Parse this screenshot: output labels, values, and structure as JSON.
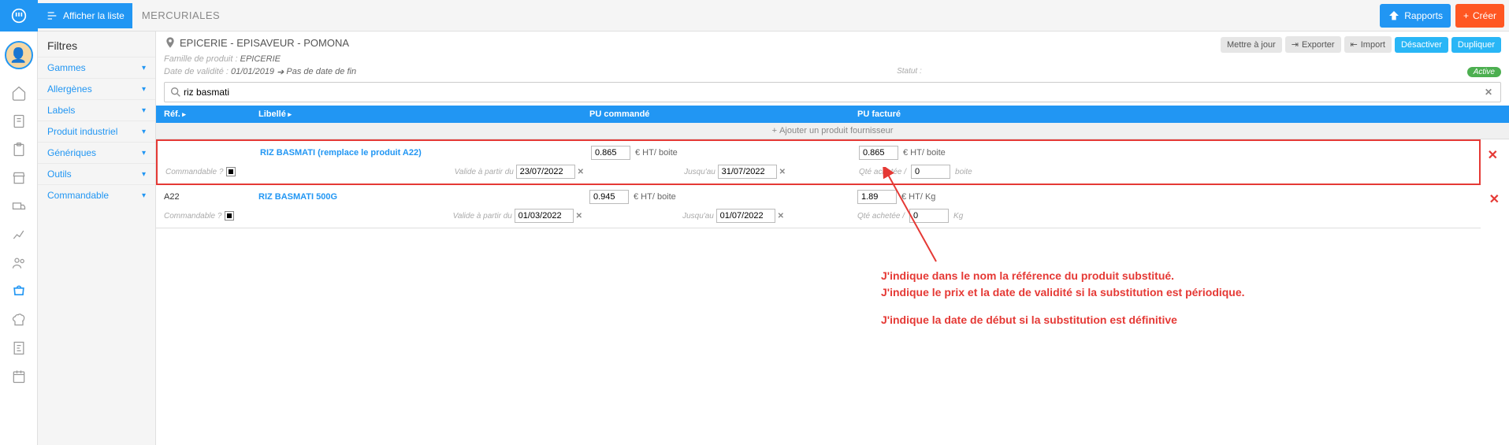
{
  "topbar": {
    "show_list": "Afficher la liste",
    "page_title": "MERCURIALES",
    "reports": "Rapports",
    "create": "Créer"
  },
  "sidebar": {
    "title": "Filtres",
    "items": [
      "Gammes",
      "Allergènes",
      "Labels",
      "Produit industriel",
      "Génériques",
      "Outils",
      "Commandable"
    ]
  },
  "header": {
    "breadcrumb": "EPICERIE - EPISAVEUR - POMONA",
    "family_label": "Famille de produit :",
    "family_value": "EPICERIE",
    "validity_label": "Date de validité :",
    "validity_start": "01/01/2019",
    "validity_arrow": "➔",
    "validity_end": "Pas de date de fin",
    "actions": {
      "update": "Mettre à jour",
      "export": "Exporter",
      "import": "Import",
      "deactivate": "Désactiver",
      "duplicate": "Dupliquer"
    },
    "status_label": "Statut :",
    "status_value": "Active"
  },
  "search": {
    "value": "riz basmati"
  },
  "columns": {
    "ref": "Réf.",
    "label": "Libellé",
    "pu_cmd": "PU commandé",
    "pu_fact": "PU facturé"
  },
  "add_row": "Ajouter un produit fournisseur",
  "row_labels": {
    "unit_prefix": "€ HT/",
    "commandable": "Commandable ?",
    "valid_from": "Valide à partir du",
    "until": "Jusqu'au",
    "qty_bought": "Qté achetée /"
  },
  "products": [
    {
      "ref": "",
      "label": "RIZ BASMATI (remplace le produit A22)",
      "pu_cmd": "0.865",
      "unit_cmd": "boite",
      "pu_fact": "0.865",
      "unit_fact": "boite",
      "valid_from": "23/07/2022",
      "until": "31/07/2022",
      "qty": "0",
      "qty_unit": "boite",
      "highlight": true
    },
    {
      "ref": "A22",
      "label": "RIZ BASMATI 500G",
      "pu_cmd": "0.945",
      "unit_cmd": "boite",
      "pu_fact": "1.89",
      "unit_fact": "Kg",
      "valid_from": "01/03/2022",
      "until": "01/07/2022",
      "qty": "0",
      "qty_unit": "Kg",
      "highlight": false
    }
  ],
  "annotations": {
    "line1": "J'indique dans le nom la référence du produit substitué.",
    "line2": "J'indique le prix et la date de validité si la substitution est périodique.",
    "line3": "J'indique la date de début si la substitution est définitive"
  }
}
